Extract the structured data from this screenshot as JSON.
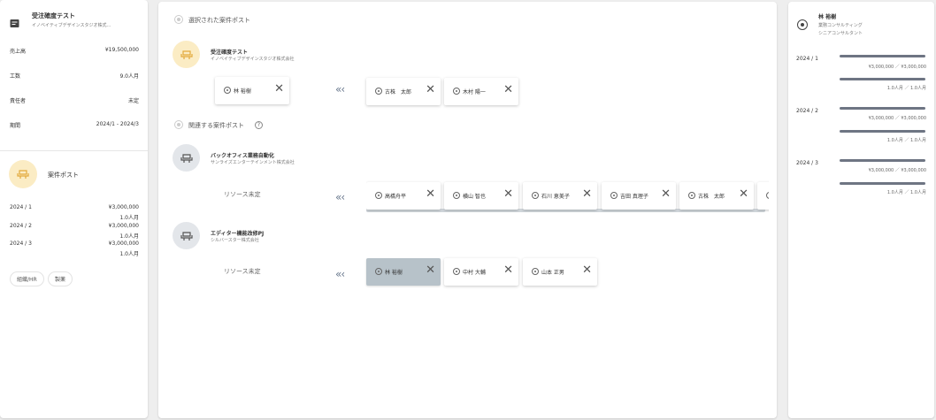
{
  "left": {
    "title": "受注確度テスト",
    "subtitle": "イノベイティブデザインスタジオ株式…",
    "details": [
      {
        "label": "売上高",
        "value": "¥19,500,000"
      },
      {
        "label": "工数",
        "value": "9.0人月"
      },
      {
        "label": "責任者",
        "value": "未定"
      },
      {
        "label": "期間",
        "value": "2024/1 - 2024/3"
      }
    ],
    "post_label": "案件ポスト",
    "periods": [
      {
        "month": "2024 / 1",
        "amount": "¥3,000,000",
        "effort": "1.0人月"
      },
      {
        "month": "2024 / 2",
        "amount": "¥3,000,000",
        "effort": "1.0人月"
      },
      {
        "month": "2024 / 3",
        "amount": "¥3,000,000",
        "effort": "1.0人月"
      }
    ],
    "tags": [
      "組織/HR",
      "製薬"
    ]
  },
  "center": {
    "selected_heading": "選択された案件ポスト",
    "related_heading": "関連する案件ポスト",
    "posts": [
      {
        "title": "受注確度テスト",
        "company": "イノベイティブデザインスタジオ株式会社",
        "assignee": "林 裕樹",
        "unassigned": "",
        "members": [
          "古株　太郎",
          "木村 陽一"
        ]
      },
      {
        "title": "バックオフィス業務自動化",
        "company": "サンライズエンターテインメント株式会社",
        "assignee": "",
        "unassigned": "リソース未定",
        "members": [
          "高橋舟平",
          "横山 智也",
          "石川 恵美子",
          "吉田 真理子",
          "古株　太郎"
        ]
      },
      {
        "title": "エディター機能改修PJ",
        "company": "シルバースター株式会社",
        "assignee": "",
        "unassigned": "リソース未定",
        "members": [
          "林 裕樹",
          "中村 大輔",
          "山本 正男"
        ]
      }
    ],
    "arrow_glyph": "«‹",
    "remove_glyph": "✕"
  },
  "right": {
    "name": "林 裕樹",
    "company": "業務コンサルティング",
    "role": "シニアコンサルタント",
    "months": [
      {
        "month": "2024 / 1",
        "amount": "¥3,000,000 ／ ¥3,000,000",
        "effort": "1.0人月 ／ 1.0人月"
      },
      {
        "month": "2024 / 2",
        "amount": "¥3,000,000 ／ ¥3,000,000",
        "effort": "1.0人月 ／ 1.0人月"
      },
      {
        "month": "2024 / 3",
        "amount": "¥3,000,000 ／ ¥3,000,000",
        "effort": "1.0人月 ／ 1.0人月"
      }
    ]
  },
  "colors": {
    "accent_yellow": "#fbecc4",
    "icon_yellow": "#e2a93b",
    "gray_circle": "#e3e6ea",
    "selected_card": "#b7c2c9"
  },
  "icons": {
    "document": "document-icon",
    "seat": "seat-icon",
    "person": "person-icon",
    "help": "help-icon",
    "remove": "close-icon",
    "arrow": "double-chevron-left-icon"
  }
}
